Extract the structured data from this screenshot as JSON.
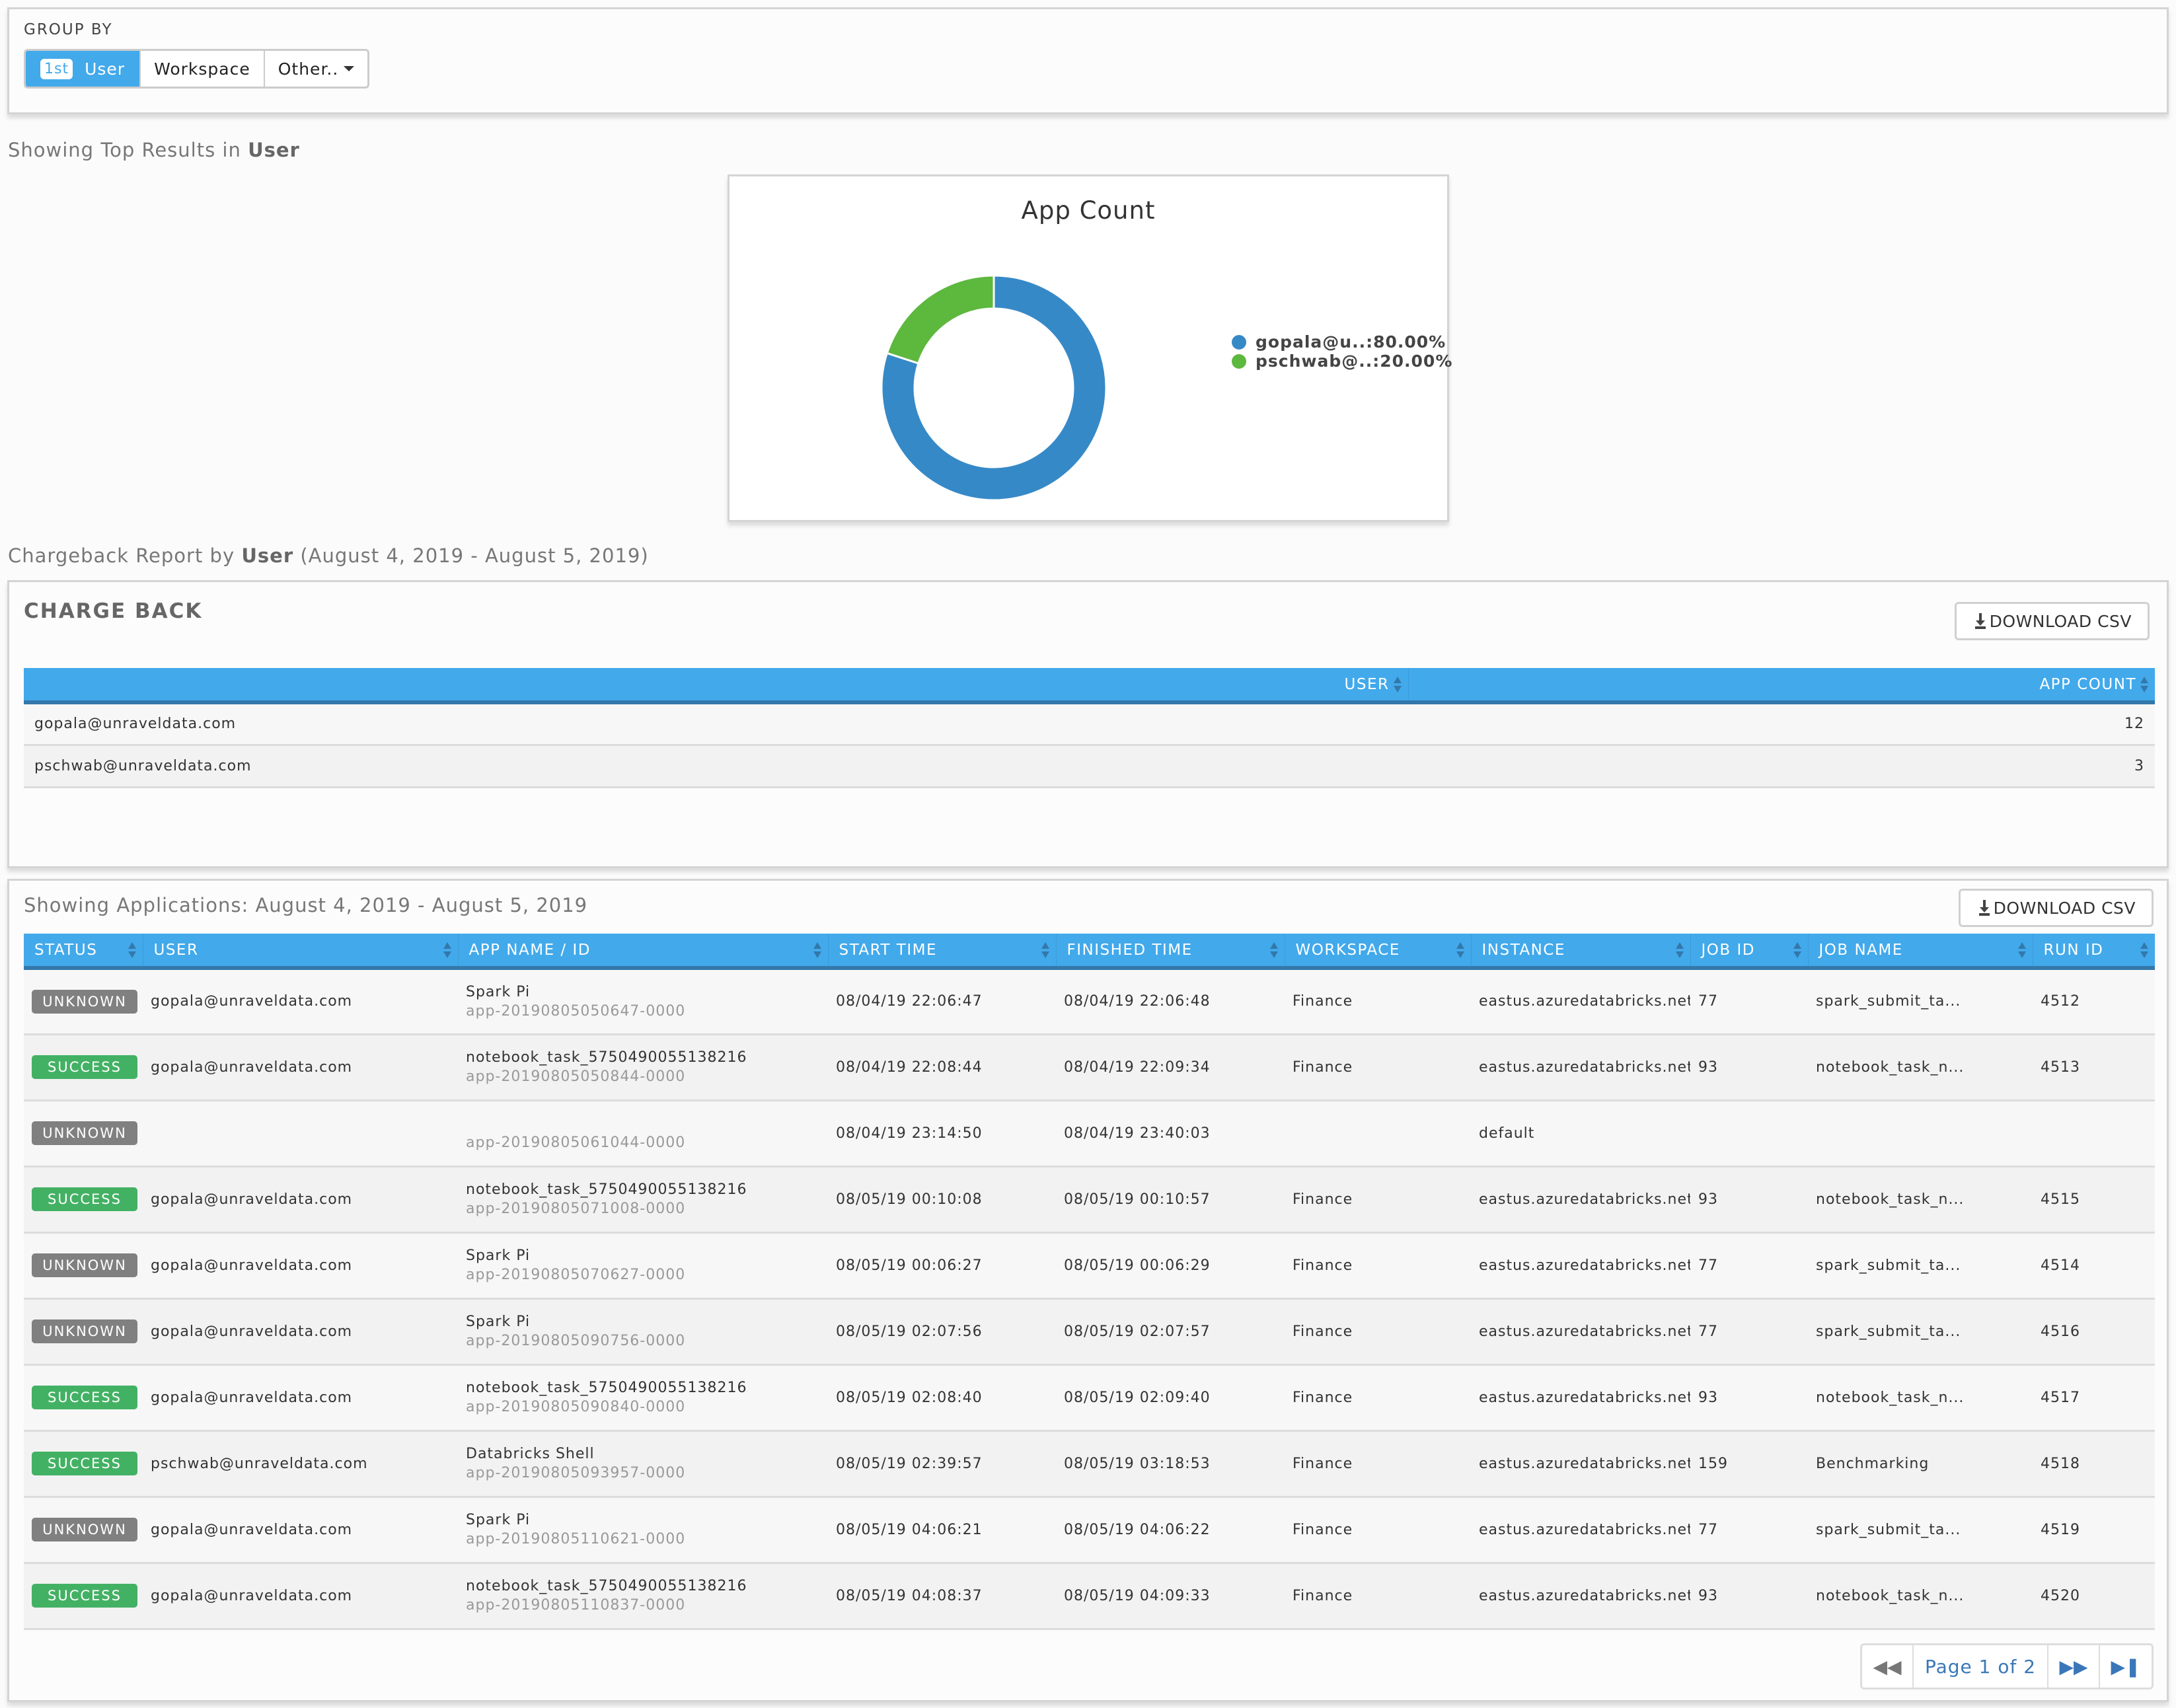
{
  "group_by": {
    "label": "GROUP BY",
    "buttons": [
      {
        "rank": "1st",
        "label": "User",
        "active": true
      },
      {
        "label": "Workspace",
        "active": false
      },
      {
        "label": "Other..",
        "active": false,
        "dropdown": true
      }
    ]
  },
  "top_results": {
    "prefix": "Showing Top Results in ",
    "group": "User"
  },
  "chart_data": {
    "type": "pie",
    "variant": "donut",
    "title": "App Count",
    "slices": [
      {
        "label": "gopala@u..",
        "value": 80.0,
        "display": "gopala@u..:80.00%",
        "color": "#3689c7"
      },
      {
        "label": "pschwab@..",
        "value": 20.0,
        "display": "pschwab@..:20.00%",
        "color": "#5db83e"
      }
    ],
    "legend_position": "right"
  },
  "chargeback_caption": {
    "prefix": "Chargeback Report by ",
    "group": "User",
    "range": " (August 4, 2019 - August 5, 2019)"
  },
  "chargeback": {
    "title": "CHARGE BACK",
    "download_label": "DOWNLOAD CSV",
    "columns": [
      "USER",
      "APP COUNT"
    ],
    "rows": [
      {
        "user": "gopala@unraveldata.com",
        "app_count": "12"
      },
      {
        "user": "pschwab@unraveldata.com",
        "app_count": "3"
      }
    ]
  },
  "applications": {
    "title": "Showing Applications: August 4, 2019 - August 5, 2019",
    "download_label": "DOWNLOAD CSV",
    "columns": [
      "STATUS",
      "USER",
      "APP NAME / ID",
      "START TIME",
      "FINISHED TIME",
      "WORKSPACE",
      "INSTANCE",
      "JOB ID",
      "JOB NAME",
      "RUN ID"
    ],
    "rows": [
      {
        "status": "UNKNOWN",
        "user": "gopala@unraveldata.com",
        "app_name": "Spark Pi",
        "app_id": "app-20190805050647-0000",
        "start": "08/04/19 22:06:47",
        "finish": "08/04/19 22:06:48",
        "workspace": "Finance",
        "instance": "eastus.azuredatabricks.net",
        "job_id": "77",
        "job_name": "spark_submit_ta...",
        "run_id": "4512"
      },
      {
        "status": "SUCCESS",
        "user": "gopala@unraveldata.com",
        "app_name": "notebook_task_5750490055138216",
        "app_id": "app-20190805050844-0000",
        "start": "08/04/19 22:08:44",
        "finish": "08/04/19 22:09:34",
        "workspace": "Finance",
        "instance": "eastus.azuredatabricks.net",
        "job_id": "93",
        "job_name": "notebook_task_n...",
        "run_id": "4513"
      },
      {
        "status": "UNKNOWN",
        "user": "",
        "app_name": "",
        "app_id": "app-20190805061044-0000",
        "start": "08/04/19 23:14:50",
        "finish": "08/04/19 23:40:03",
        "workspace": "",
        "instance": "default",
        "job_id": "",
        "job_name": "",
        "run_id": ""
      },
      {
        "status": "SUCCESS",
        "user": "gopala@unraveldata.com",
        "app_name": "notebook_task_5750490055138216",
        "app_id": "app-20190805071008-0000",
        "start": "08/05/19 00:10:08",
        "finish": "08/05/19 00:10:57",
        "workspace": "Finance",
        "instance": "eastus.azuredatabricks.net",
        "job_id": "93",
        "job_name": "notebook_task_n...",
        "run_id": "4515"
      },
      {
        "status": "UNKNOWN",
        "user": "gopala@unraveldata.com",
        "app_name": "Spark Pi",
        "app_id": "app-20190805070627-0000",
        "start": "08/05/19 00:06:27",
        "finish": "08/05/19 00:06:29",
        "workspace": "Finance",
        "instance": "eastus.azuredatabricks.net",
        "job_id": "77",
        "job_name": "spark_submit_ta...",
        "run_id": "4514"
      },
      {
        "status": "UNKNOWN",
        "user": "gopala@unraveldata.com",
        "app_name": "Spark Pi",
        "app_id": "app-20190805090756-0000",
        "start": "08/05/19 02:07:56",
        "finish": "08/05/19 02:07:57",
        "workspace": "Finance",
        "instance": "eastus.azuredatabricks.net",
        "job_id": "77",
        "job_name": "spark_submit_ta...",
        "run_id": "4516"
      },
      {
        "status": "SUCCESS",
        "user": "gopala@unraveldata.com",
        "app_name": "notebook_task_5750490055138216",
        "app_id": "app-20190805090840-0000",
        "start": "08/05/19 02:08:40",
        "finish": "08/05/19 02:09:40",
        "workspace": "Finance",
        "instance": "eastus.azuredatabricks.net",
        "job_id": "93",
        "job_name": "notebook_task_n...",
        "run_id": "4517"
      },
      {
        "status": "SUCCESS",
        "user": "pschwab@unraveldata.com",
        "app_name": "Databricks Shell",
        "app_id": "app-20190805093957-0000",
        "start": "08/05/19 02:39:57",
        "finish": "08/05/19 03:18:53",
        "workspace": "Finance",
        "instance": "eastus.azuredatabricks.net",
        "job_id": "159",
        "job_name": "Benchmarking",
        "run_id": "4518"
      },
      {
        "status": "UNKNOWN",
        "user": "gopala@unraveldata.com",
        "app_name": "Spark Pi",
        "app_id": "app-20190805110621-0000",
        "start": "08/05/19 04:06:21",
        "finish": "08/05/19 04:06:22",
        "workspace": "Finance",
        "instance": "eastus.azuredatabricks.net",
        "job_id": "77",
        "job_name": "spark_submit_ta...",
        "run_id": "4519"
      },
      {
        "status": "SUCCESS",
        "user": "gopala@unraveldata.com",
        "app_name": "notebook_task_5750490055138216",
        "app_id": "app-20190805110837-0000",
        "start": "08/05/19 04:08:37",
        "finish": "08/05/19 04:09:33",
        "workspace": "Finance",
        "instance": "eastus.azuredatabricks.net",
        "job_id": "93",
        "job_name": "notebook_task_n...",
        "run_id": "4520"
      }
    ],
    "pager": {
      "label": "Page 1 of 2",
      "first_icon": "double-chevron-left",
      "next_icon": "double-chevron-right",
      "last_icon": "skip-to-end"
    }
  },
  "colors": {
    "accent": "#42a9eb",
    "header_border": "#3378aa",
    "success": "#43b164",
    "unknown": "#808080"
  }
}
